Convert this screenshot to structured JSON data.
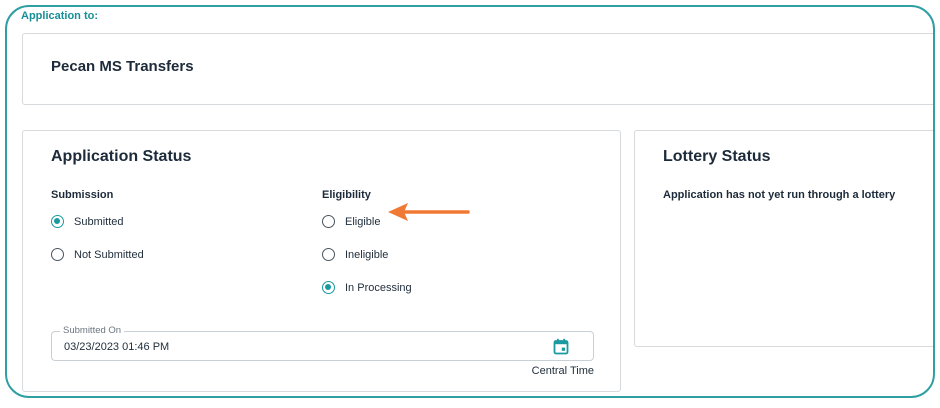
{
  "header": {
    "application_to_label": "Application to:"
  },
  "school": {
    "name": "Pecan MS Transfers"
  },
  "application_status": {
    "title": "Application Status",
    "submission": {
      "title": "Submission",
      "options": [
        {
          "label": "Submitted",
          "checked": true
        },
        {
          "label": "Not Submitted",
          "checked": false
        }
      ]
    },
    "eligibility": {
      "title": "Eligibility",
      "options": [
        {
          "label": "Eligible",
          "checked": false
        },
        {
          "label": "Ineligible",
          "checked": false
        },
        {
          "label": "In Processing",
          "checked": true
        }
      ]
    },
    "submitted_on": {
      "label": "Submitted On",
      "value": "03/23/2023 01:46 PM",
      "timezone": "Central Time",
      "icon": "calendar-icon"
    }
  },
  "lottery_status": {
    "title": "Lottery Status",
    "message": "Application has not yet run through a lottery"
  },
  "colors": {
    "accent": "#1a9aa0",
    "frame": "#2f9fa3",
    "annotation_arrow": "#f07a35"
  }
}
